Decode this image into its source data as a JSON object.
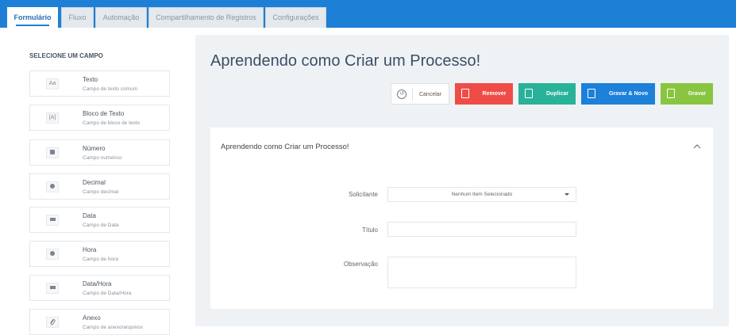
{
  "tabs": [
    {
      "label": "Formulário",
      "active": true
    },
    {
      "label": "Fluxo",
      "active": false
    },
    {
      "label": "Automação",
      "active": false
    },
    {
      "label": "Compartilhamento de Registros",
      "active": false
    },
    {
      "label": "Configurações",
      "active": false
    }
  ],
  "sidebar": {
    "title": "SELECIONE UM CAMPO",
    "fields": [
      {
        "name": "Texto",
        "description": "Campo de texto comum",
        "icon": "text-aa-icon",
        "glyph": "Aa"
      },
      {
        "name": "Bloco de Texto",
        "description": "Campo de bloco de texto",
        "icon": "text-block-icon",
        "glyph": "[A]"
      },
      {
        "name": "Número",
        "description": "Campo numérico",
        "icon": "number-icon",
        "glyph": ""
      },
      {
        "name": "Decimal",
        "description": "Campo decimal",
        "icon": "decimal-icon",
        "glyph": ""
      },
      {
        "name": "Data",
        "description": "Campo de Data",
        "icon": "calendar-icon",
        "glyph": ""
      },
      {
        "name": "Hora",
        "description": "Campo de hora",
        "icon": "clock-icon",
        "glyph": ""
      },
      {
        "name": "Data/Hora",
        "description": "Campo de Data/Hora",
        "icon": "datetime-icon",
        "glyph": ""
      },
      {
        "name": "Anexo",
        "description": "Campo de anexo/arquivos",
        "icon": "paperclip-icon",
        "glyph": ""
      }
    ]
  },
  "main": {
    "title": "Aprendendo como Criar um Processo!",
    "buttons": {
      "cancel": "Cancelar",
      "remove": "Remover",
      "duplicate": "Duplicar",
      "save_new": "Gravar & Novo",
      "save": "Gravar"
    },
    "card": {
      "title": "Aprendendo como Criar um Processo!",
      "fields": {
        "requester_label": "Solicitante",
        "requester_value": "Nenhum Item Selecionado",
        "title_label": "Título",
        "title_value": "",
        "observation_label": "Observação",
        "observation_value": ""
      }
    }
  },
  "colors": {
    "topbar": "#1d7fd6",
    "remove": "#ef4c48",
    "duplicate": "#29b29a",
    "save_new": "#1d80d9",
    "save": "#89c540"
  }
}
